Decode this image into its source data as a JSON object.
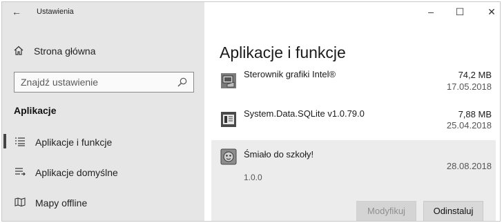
{
  "window": {
    "title": "Ustawienia",
    "controls": {
      "minimize": "–",
      "maximize": "☐",
      "close": "✕"
    }
  },
  "sidebar": {
    "back_glyph": "←",
    "home": {
      "label": "Strona główna",
      "icon": "home-icon"
    },
    "search": {
      "placeholder": "Znajdź ustawienie",
      "icon": "search-icon"
    },
    "section_title": "Aplikacje",
    "items": [
      {
        "label": "Aplikacje i funkcje",
        "icon": "apps-features-icon",
        "selected": true
      },
      {
        "label": "Aplikacje domyślne",
        "icon": "default-apps-icon",
        "selected": false
      },
      {
        "label": "Mapy offline",
        "icon": "offline-maps-icon",
        "selected": false
      }
    ]
  },
  "main": {
    "title": "Aplikacje i funkcje",
    "apps": [
      {
        "name": "Sterownik grafiki Intel®",
        "size": "74,2 MB",
        "date": "17.05.2018",
        "icon": "intel-graphics-icon"
      },
      {
        "name": "System.Data.SQLite v1.0.79.0",
        "size": "7,88 MB",
        "date": "25.04.2018",
        "icon": "installer-window-icon"
      },
      {
        "name": "Śmiało do szkoły!",
        "size": "",
        "date": "28.08.2018",
        "version": "1.0.0",
        "icon": "game-app-icon",
        "expanded": true
      }
    ],
    "buttons": {
      "modify": "Modyfikuj",
      "uninstall": "Odinstaluj"
    }
  },
  "colors": {
    "sidebar_bg": "#e6e6e6",
    "main_bg": "#ffffff",
    "selected_row_bg": "#ececec",
    "accent_bar": "#444444"
  }
}
